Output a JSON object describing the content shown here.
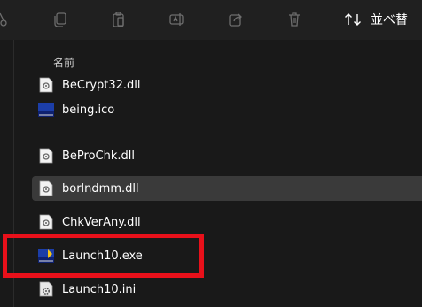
{
  "toolbar": {
    "items": [
      {
        "icon": "cut-icon"
      },
      {
        "icon": "copy-icon"
      },
      {
        "icon": "paste-icon"
      },
      {
        "icon": "rename-icon"
      },
      {
        "icon": "share-icon"
      },
      {
        "icon": "delete-icon"
      }
    ],
    "sort_label": "並べ替"
  },
  "file_list": {
    "column_name": "名前",
    "files": [
      {
        "name": "BeCrypt32.dll",
        "icon": "dll-file-icon"
      },
      {
        "name": "being.ico",
        "icon": "ico-file-icon"
      },
      {
        "name": "BeProChk.dll",
        "icon": "dll-file-icon"
      },
      {
        "name": "borlndmm.dll",
        "icon": "dll-file-icon",
        "selected": true
      },
      {
        "name": "ChkVerAny.dll",
        "icon": "dll-file-icon"
      },
      {
        "name": "Launch10.exe",
        "icon": "exe-app-icon",
        "highlighted": true
      },
      {
        "name": "Launch10.ini",
        "icon": "ini-settings-icon"
      }
    ]
  },
  "colors": {
    "background": "#191919",
    "toolbar": "#202020",
    "selection": "#3a3a3a",
    "highlight_border": "#e8101a",
    "text": "#ffffff"
  }
}
